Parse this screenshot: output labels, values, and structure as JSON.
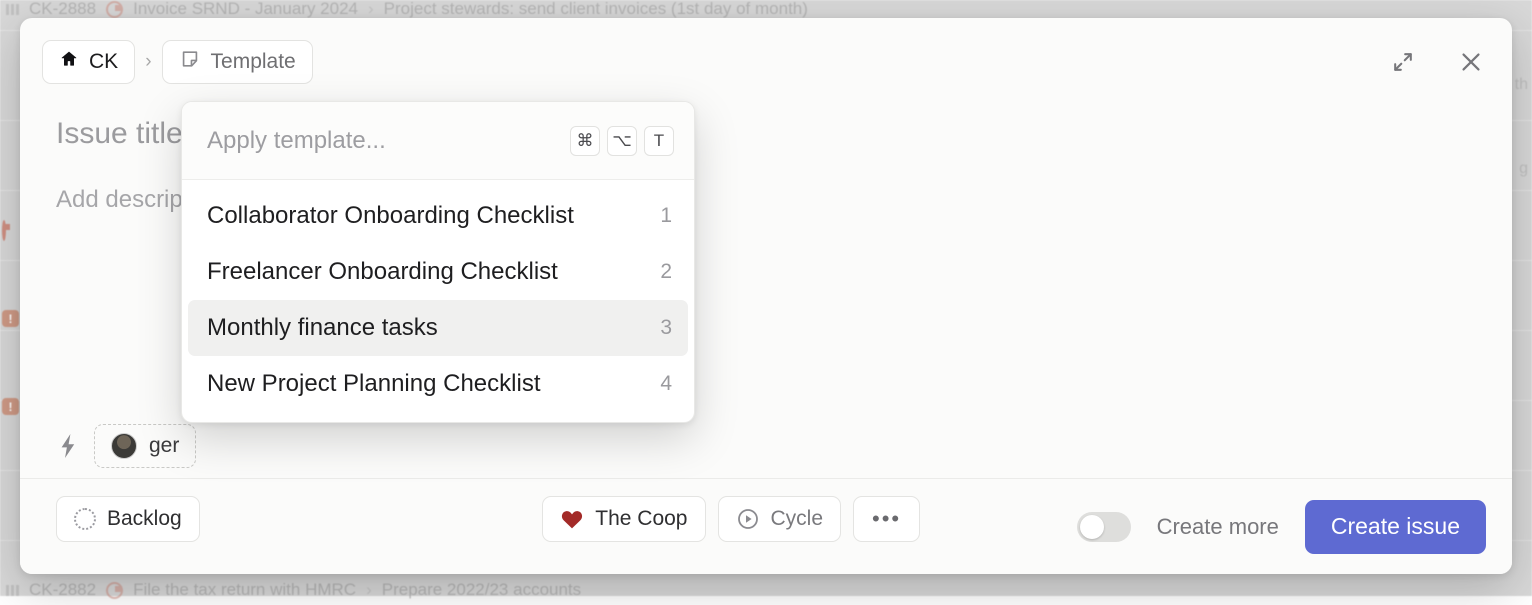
{
  "background": {
    "rows": [
      {
        "id": "CK-2888",
        "title": "Invoice SRND - January 2024",
        "sep": "›",
        "parent": "Project stewards: send client invoices (1st day of month)"
      },
      {
        "id": "CK-2882",
        "title": "File the tax return with HMRC",
        "sep": "›",
        "parent": "Prepare 2022/23 accounts"
      }
    ],
    "right_fragments": [
      "th",
      "g"
    ]
  },
  "modal": {
    "breadcrumb": {
      "workspace_label": "CK",
      "workspace_icon": "home-icon",
      "separator": "›",
      "template_label": "Template",
      "template_icon": "template-icon"
    },
    "header_actions": {
      "expand_icon": "expand-icon",
      "close_icon": "close-icon"
    },
    "title_placeholder": "Issue title",
    "description_placeholder": "Add description...",
    "assignee": {
      "bolt_icon": "lightning-bolt-icon",
      "avatar_icon": "avatar",
      "label": "ger"
    },
    "properties": [
      {
        "name": "status",
        "label": "Backlog",
        "icon": "dotted-circle-icon"
      },
      {
        "name": "project",
        "label": "The Coop",
        "icon": "heart-icon"
      },
      {
        "name": "cycle",
        "label": "Cycle",
        "icon": "play-circle-icon"
      },
      {
        "name": "more",
        "label": "•••",
        "icon": "ellipsis-icon"
      }
    ],
    "footer": {
      "attachment_icon": "paperclip-icon",
      "create_more_label": "Create more",
      "create_more_on": false,
      "submit_label": "Create issue",
      "submit_color": "#5e6ad2"
    }
  },
  "dropdown": {
    "placeholder": "Apply template...",
    "shortcut_keys": [
      "⌘",
      "⌥",
      "T"
    ],
    "items": [
      {
        "label": "Collaborator Onboarding Checklist",
        "index": "1",
        "selected": false
      },
      {
        "label": "Freelancer Onboarding Checklist",
        "index": "2",
        "selected": false
      },
      {
        "label": "Monthly finance tasks",
        "index": "3",
        "selected": true
      },
      {
        "label": "New Project Planning Checklist",
        "index": "4",
        "selected": false
      }
    ]
  }
}
